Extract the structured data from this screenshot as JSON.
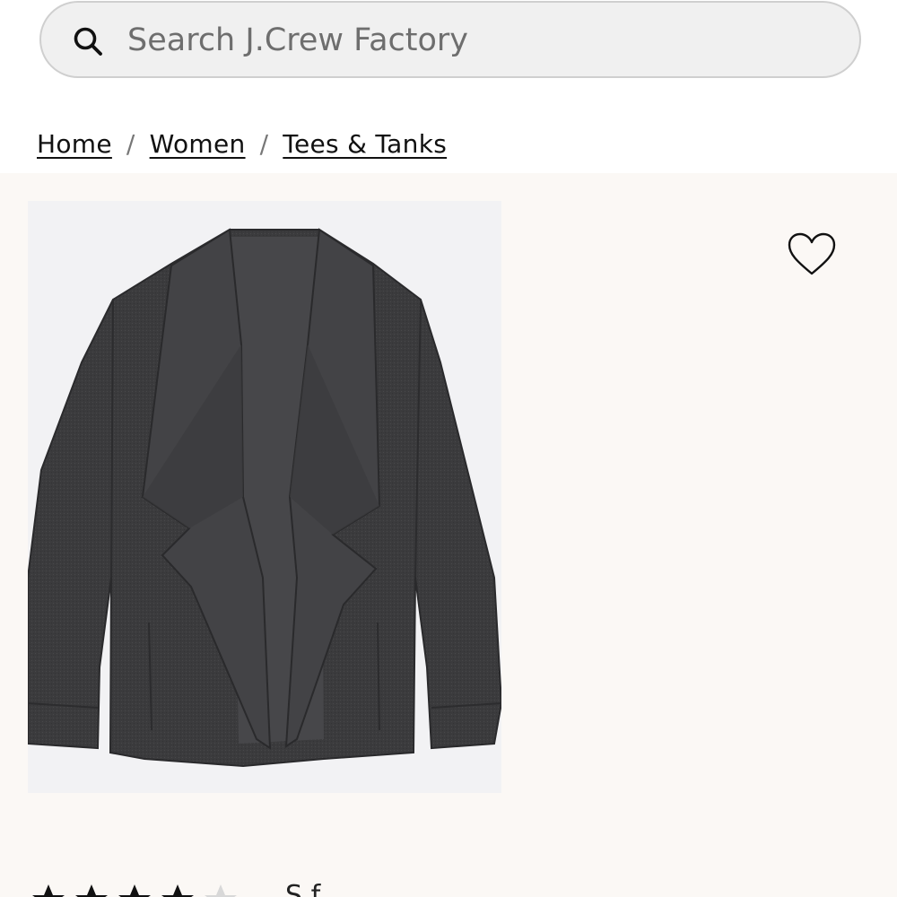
{
  "search": {
    "placeholder": "Search J.Crew Factory"
  },
  "breadcrumb": {
    "items": [
      "Home",
      "Women",
      "Tees & Tanks"
    ],
    "separator": "/"
  },
  "product": {
    "image_alt": "Charcoal draped open-front knit jacket",
    "wishlist_icon": "heart-outline-icon",
    "rating": {
      "stars_filled": 4,
      "stars_total": 5,
      "review_text": "S    f  "
    }
  },
  "colors": {
    "search_bg": "#f0f0f0",
    "panel_bg": "#fbf8f5",
    "jacket": "#3a3a3c"
  }
}
